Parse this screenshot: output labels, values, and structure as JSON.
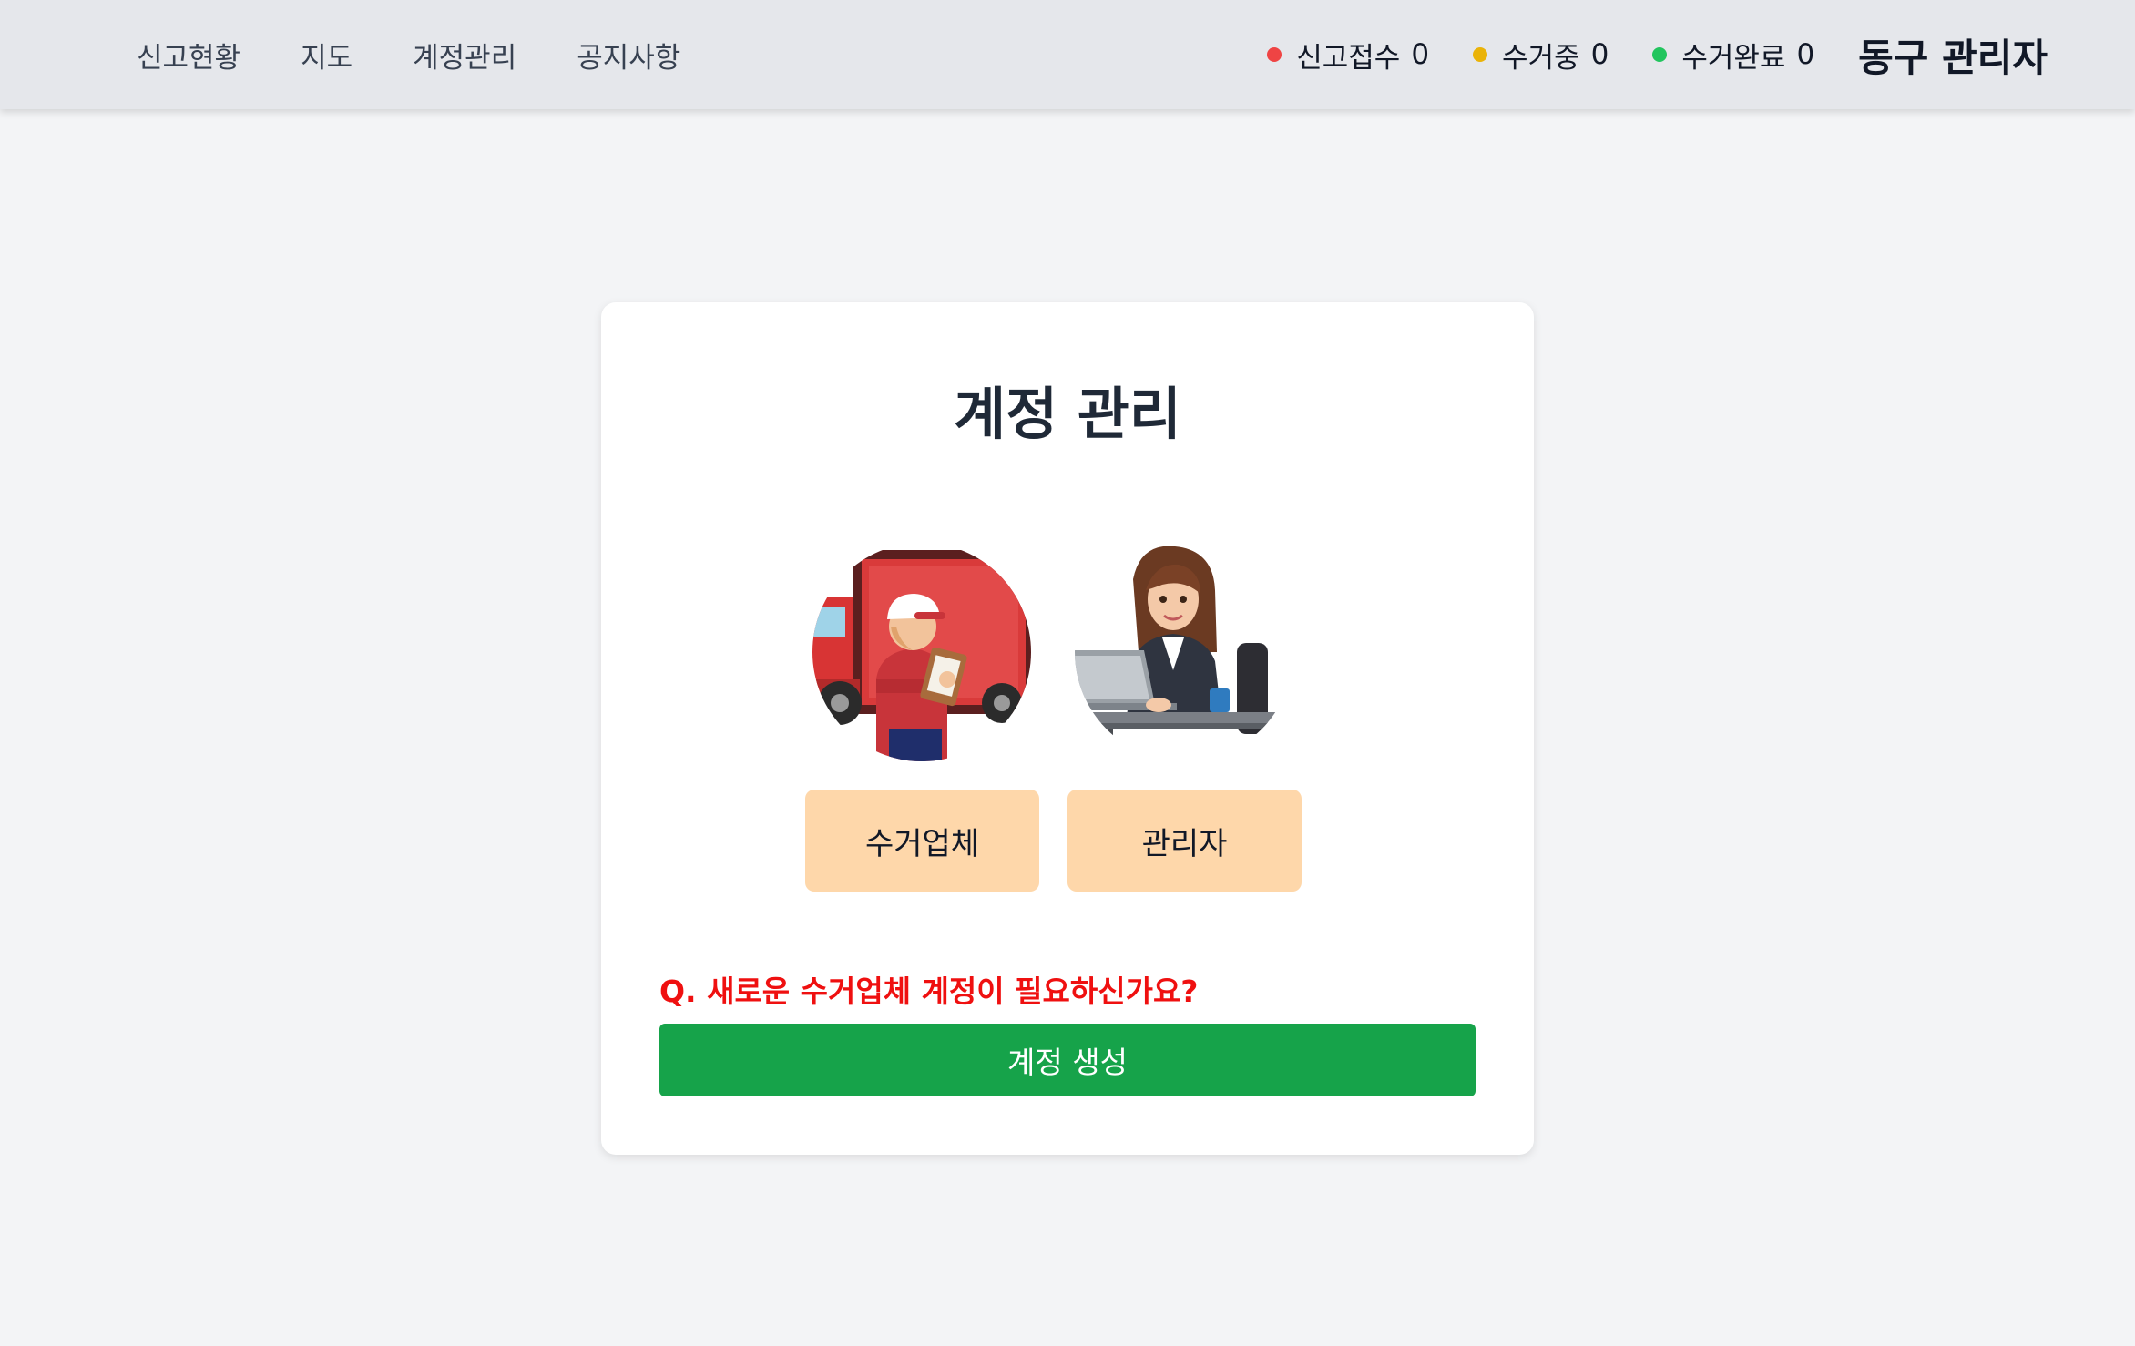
{
  "nav": {
    "items": [
      {
        "label": "신고현황"
      },
      {
        "label": "지도"
      },
      {
        "label": "계정관리"
      },
      {
        "label": "공지사항"
      }
    ]
  },
  "status": {
    "reported": {
      "label": "신고접수",
      "count": "0",
      "color": "#ef4444"
    },
    "collecting": {
      "label": "수거중",
      "count": "0",
      "color": "#eab308"
    },
    "completed": {
      "label": "수거완료",
      "count": "0",
      "color": "#22c55e"
    }
  },
  "header": {
    "admin_name": "동구 관리자"
  },
  "main": {
    "title": "계정 관리",
    "roles": {
      "collector": {
        "label": "수거업체",
        "image": "delivery-worker-truck-image"
      },
      "admin": {
        "label": "관리자",
        "image": "office-admin-laptop-image"
      }
    },
    "question": "Q. 새로운 수거업체 계정이 필요하신가요?",
    "create_button": "계정 생성"
  },
  "colors": {
    "accent_green": "#16a34a",
    "role_button_bg": "#fed7aa",
    "question_red": "#ef1010"
  }
}
